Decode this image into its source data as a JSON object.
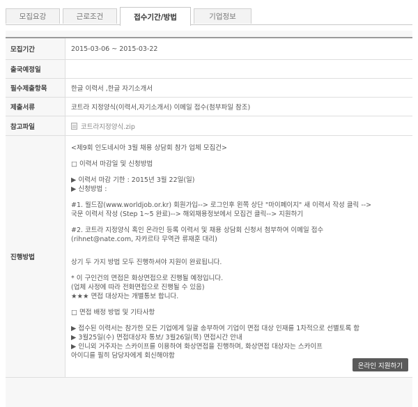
{
  "tabs": [
    {
      "label": "모집요강",
      "active": false
    },
    {
      "label": "근로조건",
      "active": false
    },
    {
      "label": "접수기간/방법",
      "active": true
    },
    {
      "label": "기업정보",
      "active": false
    }
  ],
  "rows": {
    "period": {
      "label": "모집기간",
      "value": "2015-03-06 ~ 2015-03-22"
    },
    "departure": {
      "label": "출국예정일",
      "value": ""
    },
    "required": {
      "label": "필수제출항목",
      "value": "한글 이력서 ,한글 자기소개서"
    },
    "documents": {
      "label": "제출서류",
      "value": "코트라 지정양식(이력서,자기소개서) 이메일 접수(첨부파일 참조)"
    },
    "attachment": {
      "label": "참고파일",
      "file_name": "코트라지정양식.zip",
      "icon": "file-icon"
    },
    "method": {
      "label": "진행방법",
      "lines": [
        "<제9회 인도네시아 3월 채용 상담회 참가 업체 모집건>",
        "",
        "□ 이력서 마감일 및 신청방법",
        "",
        "▶ 이력서 마감 기한 : 2015년 3월 22일(일)",
        "▶ 신청방법 :",
        "",
        "#1. 월드잡(www.worldjob.or.kr) 회원가입--> 로그인후 왼쪽 상단 \"마이페이지\" 새 이력서 작성 클릭 -->",
        "국문 이력서 작성 (Step 1~5 완료)--> 해외채용정보에서 모집건 클릭--> 지원하기",
        "",
        "#2. 코트라 지정양식 혹인 온라인 등록 이력서 및 채용 상담회 신청서 첨부하여 이메일 접수",
        "(rihnet@nate.com, 자카르타 무역관 류재훈 대리)",
        "",
        "",
        "상기 두 가지 방법 모두 진행하셔야 지원이 완료됩니다.",
        "",
        "* 이 구인건의 면접은 화상면접으로 진행될 예정입니다.",
        "(업체 사정에 따라 전화면접으로 진행될 수 있음)",
        "★★★ 면접 대상자는 개별통보 합니다.",
        "",
        "□ 면접 배정 방법 및 기타사항",
        "",
        "▶ 접수된 이력서는 참가한 모든 기업에게 일괄 송부하여 기업이 면접 대상 인재를 1차적으로 선별토록 함",
        "▶ 3월25일(수) 면접대상자 통보/ 3월26일(목) 면접시간 안내",
        "▶ 인니외 거주자는 스카이프를 이용하여 화상면접을 진행하며, 화상면접 대상자는 스카이프",
        "아이디를 필히 담당자에게 회신해야함"
      ],
      "apply_button": "온라인 지원하기"
    }
  }
}
